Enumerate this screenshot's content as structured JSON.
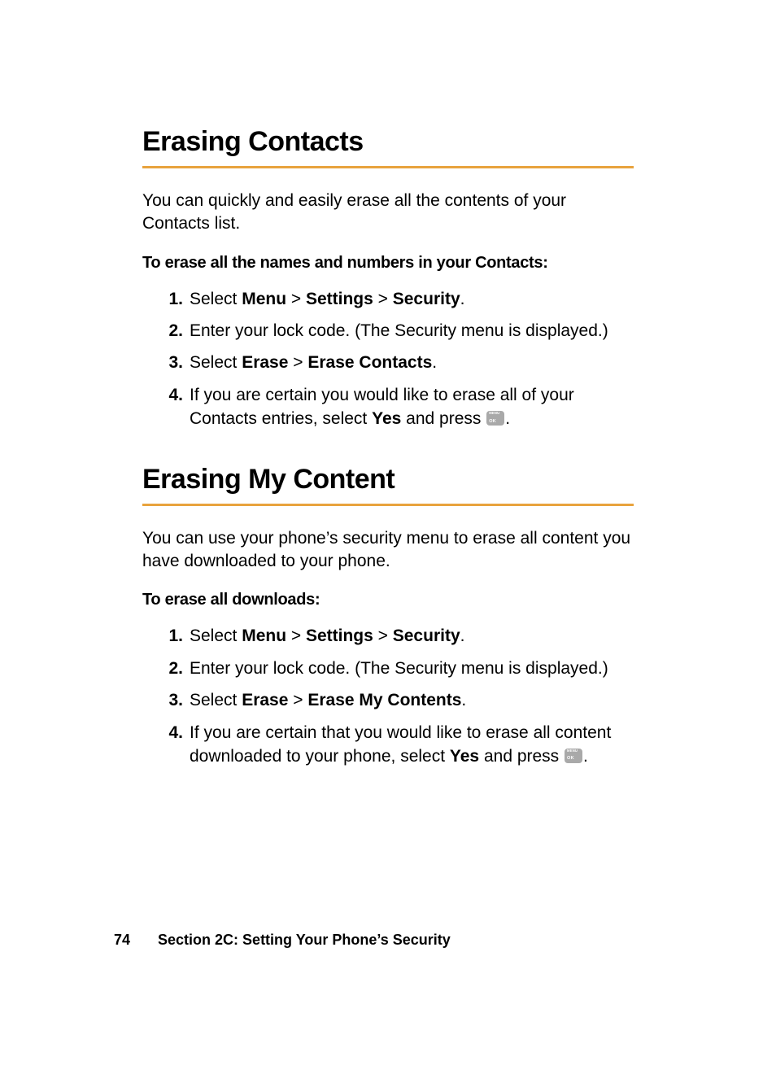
{
  "s1": {
    "heading": "Erasing Contacts",
    "intro": "You can quickly and easily erase all the contents of your Contacts list.",
    "subhead": "To erase all the names and numbers in your Contacts:",
    "step1": {
      "pre": "Select ",
      "m": "Menu",
      "sep1": " > ",
      "set": "Settings",
      "sep2": " > ",
      "sec": "Security",
      "post": "."
    },
    "step2": "Enter your lock code. (The Security menu is displayed.)",
    "step3": {
      "pre": "Select ",
      "e": "Erase",
      "sep1": " > ",
      "ec": "Erase Contacts",
      "post": "."
    },
    "step4": {
      "pre": "If you are certain you would like to erase all of your Contacts entries, select ",
      "yes": "Yes",
      "mid": " and press ",
      "post": "."
    }
  },
  "s2": {
    "heading": "Erasing My Content",
    "intro": "You can use your phone’s security menu to erase all content you have downloaded to your phone.",
    "subhead": "To erase all downloads:",
    "step1": {
      "pre": "Select ",
      "m": "Menu",
      "sep1": " > ",
      "set": "Settings",
      "sep2": " > ",
      "sec": "Security",
      "post": "."
    },
    "step2": "Enter your lock code. (The Security menu is displayed.)",
    "step3": {
      "pre": "Select ",
      "e": "Erase",
      "sep1": " > ",
      "emc": "Erase My Contents",
      "post": "."
    },
    "step4": {
      "pre": "If you are certain that you would like to erase all content downloaded to your phone, select ",
      "yes": "Yes",
      "mid": " and press ",
      "post": "."
    }
  },
  "footer": {
    "page": "74",
    "section": "Section 2C: Setting Your Phone’s Security"
  }
}
